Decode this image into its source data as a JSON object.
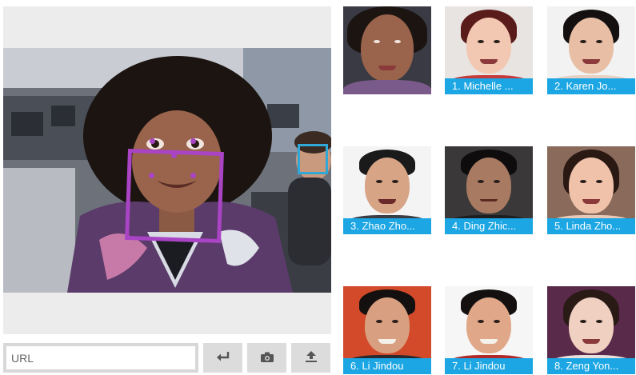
{
  "input": {
    "url_placeholder": "URL"
  },
  "controls": [
    {
      "name": "enter-button",
      "icon": "enter-icon"
    },
    {
      "name": "camera-button",
      "icon": "camera-icon"
    },
    {
      "name": "upload-button",
      "icon": "upload-icon"
    }
  ],
  "colors": {
    "detection_primary": "#a944c4",
    "detection_secondary": "#2fa8d8",
    "caption_bar": "#1ca6e3",
    "panel_bg": "#ececec",
    "button_bg": "#dcdcdc"
  },
  "query_thumbnail": {
    "caption": ""
  },
  "results": [
    {
      "label": "1. Michelle ..."
    },
    {
      "label": "2. Karen Jo..."
    },
    {
      "label": "3. Zhao Zho..."
    },
    {
      "label": "4. Ding Zhic..."
    },
    {
      "label": "5. Linda Zho..."
    },
    {
      "label": "6. Li Jindou"
    },
    {
      "label": "7. Li Jindou"
    },
    {
      "label": "8. Zeng Yon..."
    }
  ]
}
